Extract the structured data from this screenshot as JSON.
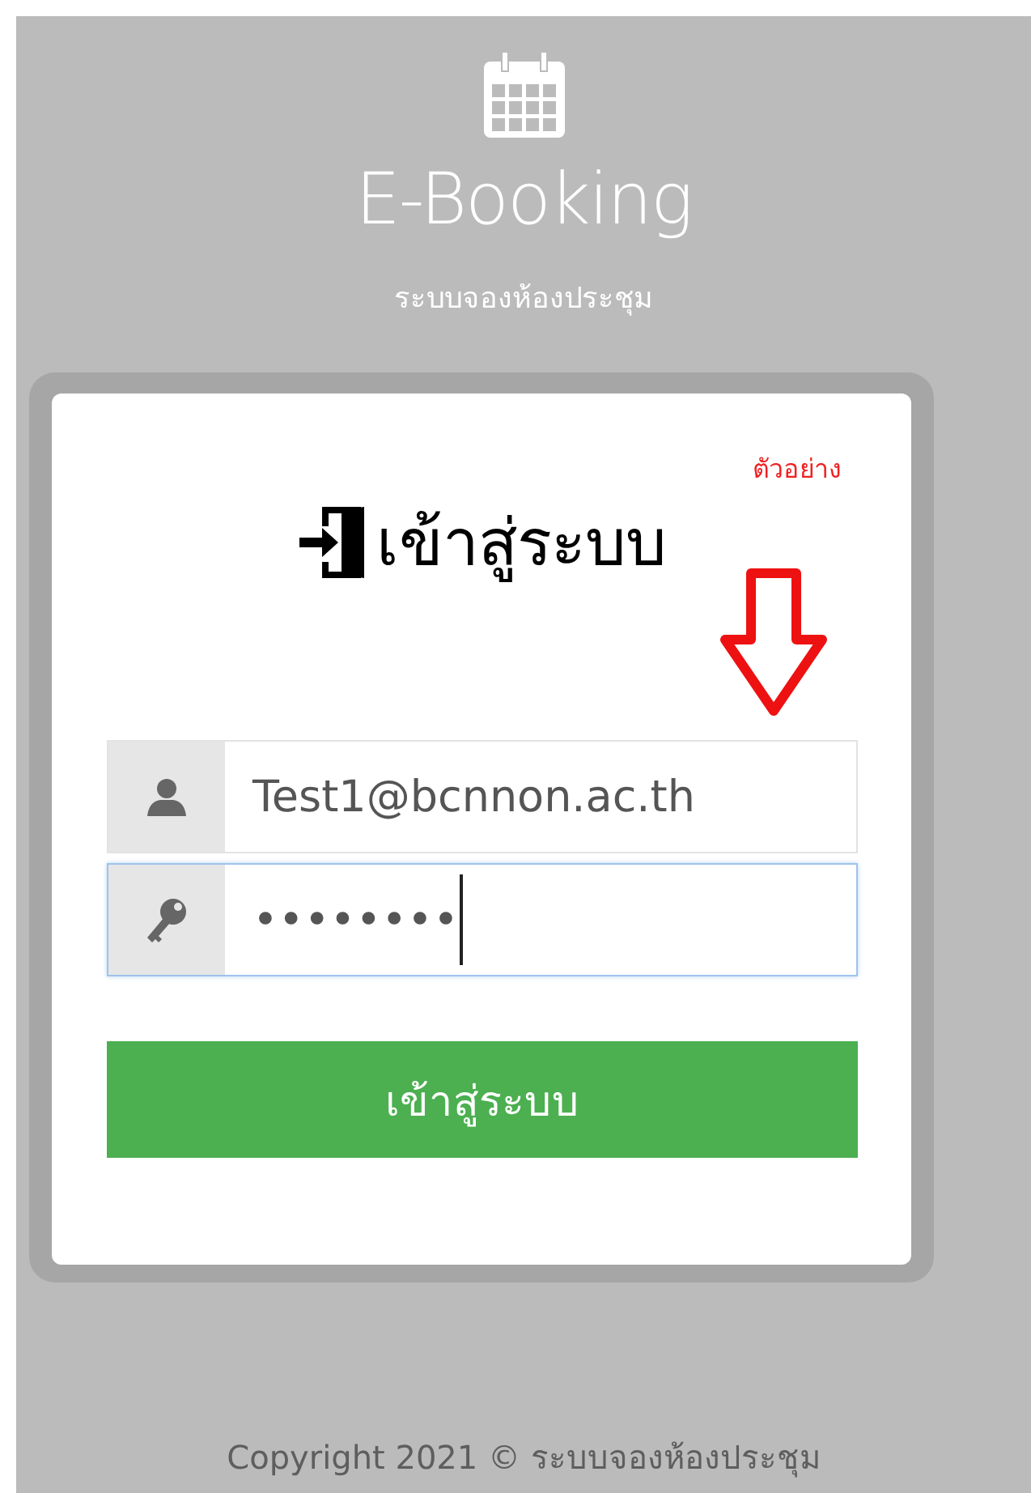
{
  "header": {
    "title": "E-Booking",
    "subtitle": "ระบบจองห้องประชุม"
  },
  "login": {
    "title": "เข้าสู่ระบบ",
    "note": "ตัวอย่าง",
    "fields": [
      {
        "kind": "email",
        "value": "Test1@bcnnon.ac.th",
        "focused": false
      },
      {
        "kind": "password",
        "value": "••••••••",
        "focused": true
      }
    ],
    "button": "เข้าสู่ระบบ"
  },
  "footer": "Copyright 2021 © ระบบจองห้องประชุม"
}
